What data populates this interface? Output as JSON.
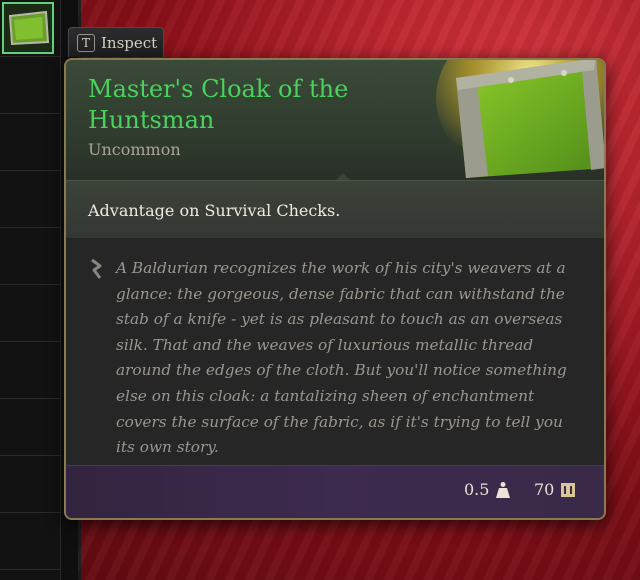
{
  "inspect": {
    "key": "T",
    "label": "Inspect"
  },
  "item": {
    "name": "Master's Cloak of the Huntsman",
    "rarity": "Uncommon",
    "effect": "Advantage on Survival Checks.",
    "description": "A Baldurian recognizes the work of his city's weavers at a glance: the gorgeous, dense fabric that can withstand the stab of a knife - yet is as pleasant to touch as an overseas silk. That and the weaves of luxurious metallic thread around the edges of the cloth. But you'll notice something else on this cloak: a tantalizing sheen of enchantment covers the surface of the fabric, as if it's trying to tell you its own story.",
    "weight": "0.5",
    "value": "70"
  },
  "icons": {
    "weight": "weight-icon",
    "gold": "gold-coin-icon",
    "lore": "lore-quill-icon",
    "item": "cloak-icon"
  },
  "colors": {
    "title": "#49d25e",
    "rarity": "#a9a59a",
    "border": "#8a7a52"
  }
}
